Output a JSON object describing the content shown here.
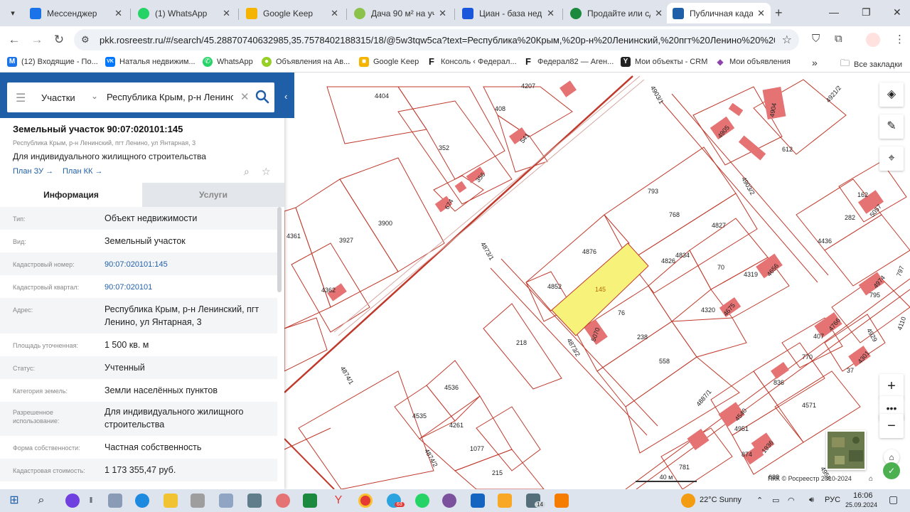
{
  "browser": {
    "tabs": [
      {
        "label": "Мессенджер",
        "color": "#1a73e8"
      },
      {
        "label": "(1) WhatsApp",
        "color": "#25d366"
      },
      {
        "label": "Google Keep",
        "color": "#f4b400"
      },
      {
        "label": "Дача 90 м² на уча",
        "color": "#8bc34a"
      },
      {
        "label": "Циан - база недви",
        "color": "#1a56db"
      },
      {
        "label": "Продайте или сда",
        "color": "#1b8a3e"
      },
      {
        "label": "Публичная кадаст",
        "color": "#1f5fa8"
      }
    ],
    "url": "pkk.rosreestr.ru/#/search/45.28870740632985,35.7578402188315/18/@5w3tqw5ca?text=Республика%20Крым,%20р-н%20Ленинский,%20пгт%20Ленино%20%20ул.%20...",
    "bookmarks": [
      {
        "label": "(12) Входящие - По...",
        "icon": "M",
        "color": "#1a73e8"
      },
      {
        "label": "Наталья недвижим...",
        "icon": "VK",
        "color": "#0077ff"
      },
      {
        "label": "WhatsApp",
        "icon": "✆",
        "color": "#25d366"
      },
      {
        "label": "Объявления на Ав...",
        "icon": "●",
        "color": "#97cf26"
      },
      {
        "label": "Google Keep",
        "icon": "■",
        "color": "#f4b400"
      },
      {
        "label": "Консоль ‹ Федерал...",
        "icon": "F",
        "color": "#111111"
      },
      {
        "label": "Федерал82 — Аген...",
        "icon": "F",
        "color": "#111111"
      },
      {
        "label": "Мои объекты - CRM",
        "icon": "Y",
        "color": "#222222"
      },
      {
        "label": "Мои объявления",
        "icon": "◆",
        "color": "#8e44ad"
      }
    ],
    "all_bookmarks": "Все закладки"
  },
  "search": {
    "type": "Участки",
    "query": "Республика Крым, р-н Ленинский"
  },
  "object": {
    "title": "Земельный участок 90:07:020101:145",
    "address": "Республика Крым, р-н Ленинский, пгт Ленино, ул Янтарная, 3",
    "use": "Для индивидуального жилищного строительства",
    "plan_zu": "План ЗУ",
    "plan_kk": "План КК"
  },
  "panel_tabs": {
    "info": "Информация",
    "services": "Услуги"
  },
  "rows": [
    {
      "k": "Тип:",
      "v": "Объект недвижимости"
    },
    {
      "k": "Вид:",
      "v": "Земельный участок"
    },
    {
      "k": "Кадастровый номер:",
      "v": "90:07:020101:145"
    },
    {
      "k": "Кадастровый квартал:",
      "v": "90:07:020101"
    },
    {
      "k": "Адрес:",
      "v": "Республика Крым, р-н Ленинский, пгт Ленино, ул Янтарная, 3"
    },
    {
      "k": "Площадь уточненная:",
      "v": "1 500 кв. м"
    },
    {
      "k": "Статус:",
      "v": "Учтенный"
    },
    {
      "k": "Категория земель:",
      "v": "Земли населённых пунктов"
    },
    {
      "k": "Разрешенное использование:",
      "v": "Для индивидуального жилищного строительства"
    },
    {
      "k": "Форма собственности:",
      "v": "Частная собственность"
    },
    {
      "k": "Кадастровая стоимость:",
      "v": "1 173 355,47 руб."
    }
  ],
  "map": {
    "parcels": [
      "4404",
      "4207",
      "408",
      "541",
      "352",
      "356",
      "674",
      "4361",
      "3927",
      "3900",
      "4362",
      "4873/1",
      "4874/1",
      "218",
      "4536",
      "4535",
      "4261",
      "1077",
      "215",
      "793",
      "768",
      "4876",
      "4852",
      "145",
      "76",
      "5070",
      "238",
      "558",
      "4873/2",
      "4826",
      "4834",
      "4827",
      "70",
      "4319",
      "4656",
      "4320",
      "4675",
      "4905",
      "4904",
      "612",
      "4903/1",
      "4903/2",
      "4921/2",
      "162",
      "5057",
      "282",
      "4436",
      "797",
      "4974",
      "795",
      "407",
      "4766",
      "4929",
      "770",
      "37",
      "4301",
      "4110",
      "836",
      "4571",
      "4887/1",
      "4540",
      "4951",
      "874",
      "1936",
      "781",
      "688",
      "4958",
      "4874/2"
    ],
    "scale": "40 м",
    "copyright": "ПКК © Росреестр 2010-2024"
  },
  "taskbar": {
    "weather": "22°C  Sunny",
    "lang": "РУС",
    "time": "16:06",
    "date": "25.09.2024",
    "badge_telegram": "63",
    "badge_14": "14"
  }
}
